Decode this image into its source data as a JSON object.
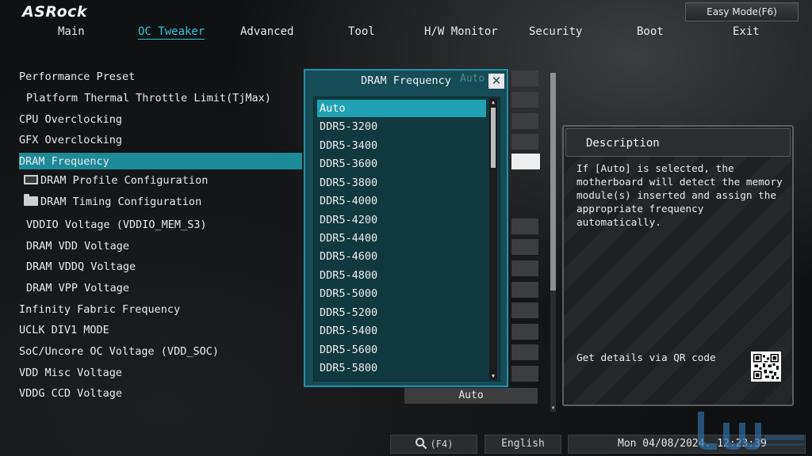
{
  "brand": "ASRock",
  "easy_mode_label": "Easy Mode(F6)",
  "nav": [
    "Main",
    "OC Tweaker",
    "Advanced",
    "Tool",
    "H/W Monitor",
    "Security",
    "Boot",
    "Exit"
  ],
  "active_nav": "OC Tweaker",
  "settings": [
    "Performance Preset",
    "Platform Thermal Throttle Limit(TjMax)",
    "CPU Overclocking",
    "GFX Overclocking",
    "DRAM Frequency",
    "DRAM Profile Configuration",
    "DRAM Timing Configuration",
    "VDDIO Voltage (VDDIO_MEM_S3)",
    "DRAM VDD Voltage",
    "DRAM VDDQ Voltage",
    "DRAM VPP Voltage",
    "Infinity Fabric Frequency",
    "UCLK DIV1 MODE",
    "SoC/Uncore OC Voltage (VDD_SOC)",
    "VDD Misc Voltage",
    "VDDG CCD Voltage"
  ],
  "selected_setting": "DRAM Frequency",
  "bottom_value": "Auto",
  "popup": {
    "title": "DRAM Frequency",
    "ghost_value": "Auto",
    "close_label": "✕",
    "options": [
      "Auto",
      "DDR5-3200",
      "DDR5-3400",
      "DDR5-3600",
      "DDR5-3800",
      "DDR5-4000",
      "DDR5-4200",
      "DDR5-4400",
      "DDR5-4600",
      "DDR5-4800",
      "DDR5-5000",
      "DDR5-5200",
      "DDR5-5400",
      "DDR5-5600",
      "DDR5-5800"
    ],
    "selected_option": "Auto"
  },
  "description": {
    "title": "Description",
    "text": "If [Auto] is selected, the\nmotherboard will detect the memory\nmodule(s) inserted and assign the\nappropriate frequency automatically.",
    "qr_label": "Get details via QR code"
  },
  "footer": {
    "search_label": "(F4)",
    "language": "English",
    "datetime": "Mon 04/08/2024. 12:23:39"
  },
  "colors": {
    "accent": "#33c6d8",
    "highlight": "#1c8a99",
    "popup_bg": "#164c56",
    "popup_selected": "#21a1b3"
  }
}
